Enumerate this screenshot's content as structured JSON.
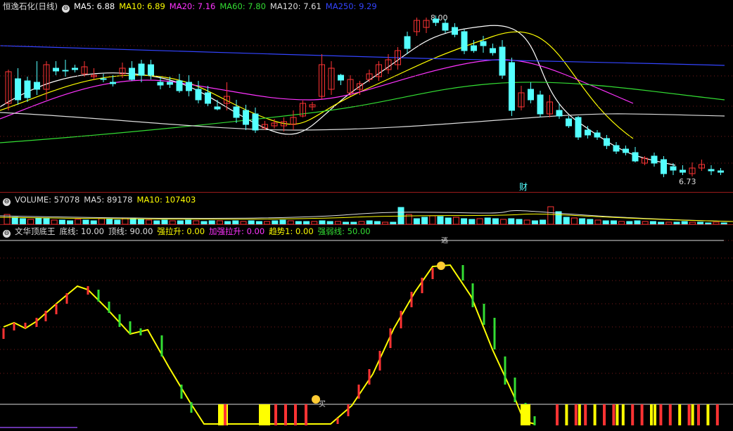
{
  "stock_title": "恒逸石化(日线)",
  "ma_legend": [
    {
      "label": "MA5: 6.88",
      "color": "#ffffff"
    },
    {
      "label": "MA10: 6.89",
      "color": "#ffff00"
    },
    {
      "label": "MA20: 7.16",
      "color": "#ff33ff"
    },
    {
      "label": "MA60: 7.80",
      "color": "#33dd33"
    },
    {
      "label": "MA120: 7.61",
      "color": "#dddddd"
    },
    {
      "label": "MA250: 9.29",
      "color": "#3344ff"
    }
  ],
  "price_annotations": {
    "high": "8.00",
    "low": "6.73",
    "event": "财"
  },
  "volume_legend": [
    {
      "label": "VOLUME: 57078",
      "color": "#dddddd"
    },
    {
      "label": "MA5: 89178",
      "color": "#dddddd"
    },
    {
      "label": "MA10: 107403",
      "color": "#ffff00"
    }
  ],
  "indicator_legend": [
    {
      "label": "文华顶底王",
      "color": "#dddddd"
    },
    {
      "label": "底线: 10.00",
      "color": "#dddddd"
    },
    {
      "label": "顶线: 90.00",
      "color": "#dddddd"
    },
    {
      "label": "强拉升: 0.00",
      "color": "#ffff00"
    },
    {
      "label": "加强拉升: 0.00",
      "color": "#ff33ff"
    },
    {
      "label": "趋势1: 0.00",
      "color": "#ffff00"
    },
    {
      "label": "强弱线: 50.00",
      "color": "#33dd33"
    }
  ],
  "indicator_marks": {
    "sell": "逃",
    "buy": "买"
  },
  "colors": {
    "up": "#ff3333",
    "down": "#54ffff",
    "frame": "#9b1b1b",
    "grid": "#7a1a1a"
  },
  "chart_data": [
    {
      "type": "candlestick",
      "title": "恒逸石化(日线)",
      "high_label": 8.0,
      "low_label": 6.73,
      "series": [
        {
          "name": "MA5",
          "value": 6.88
        },
        {
          "name": "MA10",
          "value": 6.89
        },
        {
          "name": "MA20",
          "value": 7.16
        },
        {
          "name": "MA60",
          "value": 7.8
        },
        {
          "name": "MA120",
          "value": 7.61
        },
        {
          "name": "MA250",
          "value": 9.29
        }
      ]
    },
    {
      "type": "bar",
      "title": "VOLUME",
      "values_latest": {
        "VOLUME": 57078,
        "MA5": 89178,
        "MA10": 107403
      }
    },
    {
      "type": "line",
      "title": "文华顶底王",
      "ylim": [
        0,
        100
      ],
      "series": [
        {
          "name": "底线",
          "value": 10
        },
        {
          "name": "顶线",
          "value": 90
        },
        {
          "name": "强拉升",
          "value": 0
        },
        {
          "name": "加强拉升",
          "value": 0
        },
        {
          "name": "趋势1",
          "value": 0
        },
        {
          "name": "强弱线",
          "value": 50
        }
      ]
    }
  ]
}
